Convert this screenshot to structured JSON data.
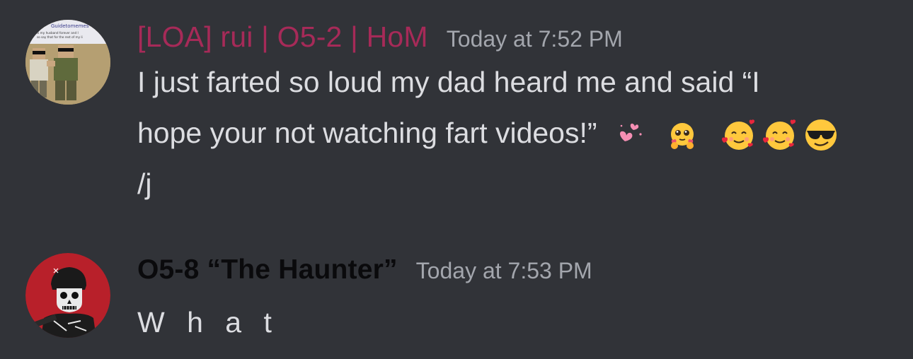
{
  "messages": [
    {
      "username": "[LOA] rui | O5-2 | HoM",
      "timestamp": "Today at 7:52 PM",
      "lines": [
        "I just farted so loud my dad heard me and said “I",
        "hope your not watching fart videos!”",
        "/j"
      ],
      "emojis": [
        "two-hearts-icon",
        "hugging-face-icon",
        "smiling-face-with-hearts-icon",
        "smiling-face-with-hearts-icon",
        "smiling-face-with-sunglasses-icon"
      ],
      "avatar_text": {
        "banner": "Guidetomemes",
        "line1": "is my husband forever and I",
        "line2": "so say that for the rest of my li"
      },
      "name_color": "#a62a58"
    },
    {
      "username": "O5-8 “The Haunter”",
      "timestamp": "Today at 7:53 PM",
      "lines": [
        "W h a t"
      ],
      "avatar_bg": "#b8202a",
      "name_color": "#0a0a0c"
    }
  ],
  "colors": {
    "background": "#313338",
    "text": "#dcdde1",
    "timestamp": "#a3a6ad"
  }
}
